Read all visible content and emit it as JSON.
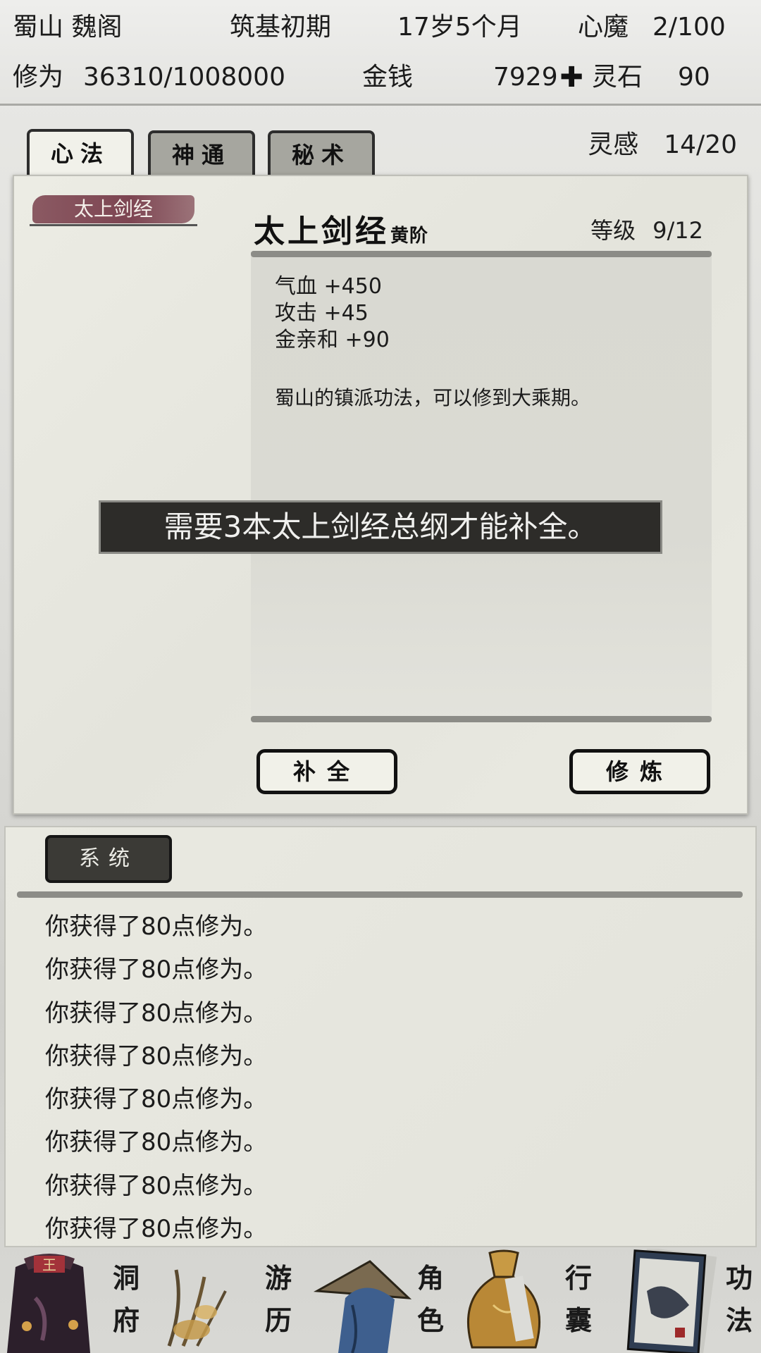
{
  "header": {
    "sect_name": "蜀山 魏阁",
    "realm": "筑基初期",
    "age": "17岁5个月",
    "inner_demon_label": "心魔",
    "inner_demon_value": "2/100",
    "cultivation_label": "修为",
    "cultivation_value": "36310/1008000",
    "money_label": "金钱",
    "money_value": "7929",
    "spirit_stone_label": "灵石",
    "spirit_stone_value": "90"
  },
  "tabs": [
    {
      "label": "心法",
      "active": true
    },
    {
      "label": "神通",
      "active": false
    },
    {
      "label": "秘术",
      "active": false
    }
  ],
  "inspiration": {
    "label": "灵感",
    "value": "14/20"
  },
  "skill": {
    "tag": "太上剑经",
    "name": "太上剑经",
    "grade": "黄阶",
    "level_label": "等级",
    "level_value": "9/12",
    "stats": [
      "气血 +450",
      "攻击 +45",
      "金亲和 +90"
    ],
    "description": "蜀山的镇派功法，可以修到大乘期。"
  },
  "toast": "需要3本太上剑经总纲才能补全。",
  "buttons": {
    "complete": "补全",
    "cultivate": "修炼"
  },
  "log": {
    "tab_label": "系统",
    "entries": [
      "你获得了80点修为。",
      "你获得了80点修为。",
      "你获得了80点修为。",
      "你获得了80点修为。",
      "你获得了80点修为。",
      "你获得了80点修为。",
      "你获得了80点修为。",
      "你获得了80点修为。"
    ]
  },
  "nav": {
    "cave": [
      "洞",
      "府"
    ],
    "travel": [
      "游",
      "历"
    ],
    "character": [
      "角",
      "色"
    ],
    "bag": [
      "行",
      "囊"
    ],
    "skills": [
      "功",
      "法"
    ]
  },
  "colors": {
    "skill_tag": "#7d4552",
    "toast_bg": "#2d2c29",
    "panel_bg": "#ecece4"
  }
}
